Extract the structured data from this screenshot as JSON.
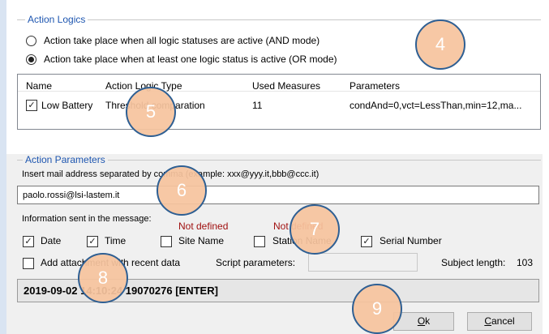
{
  "action_logics": {
    "title": "Action Logics",
    "option_and": "Action take place when all logic statuses are active (AND mode)",
    "option_or": "Action take place when at least one logic status is active (OR mode)",
    "selected": "or"
  },
  "logic_table": {
    "columns": [
      "Name",
      "Action Logic Type",
      "Used Measures",
      "Parameters"
    ],
    "rows": [
      {
        "checked": true,
        "name": "Low Battery",
        "type": "Threshold comparation",
        "measures": "11",
        "parameters": "condAnd=0,vct=LessThan,min=12,ma..."
      }
    ]
  },
  "action_parameters": {
    "title": "Action Parameters",
    "mail_label": "Insert mail address separated by comma (example: xxx@yyy.it,bbb@ccc.it)",
    "mail_value": "paolo.rossi@lsi-lastem.it",
    "info_label": "Information sent in the message:",
    "not_defined_1": "Not defined",
    "not_defined_2": "Not defined",
    "checkboxes": [
      {
        "label": "Date",
        "checked": true
      },
      {
        "label": "Time",
        "checked": true
      },
      {
        "label": "Site Name",
        "checked": false
      },
      {
        "label": "Station Name",
        "checked": false
      },
      {
        "label": "Serial Number",
        "checked": true
      }
    ],
    "attachment_label": "Add attachment with recent data",
    "attachment_checked": false,
    "script_label": "Script parameters:",
    "script_value": "",
    "subject_length_label": "Subject length:",
    "subject_length_value": "103",
    "preview": "2019-09-02 14:10:24 19070276 [ENTER]"
  },
  "buttons": {
    "ok_mnemonic": "O",
    "ok_rest": "k",
    "cancel_mnemonic": "C",
    "cancel_rest": "ancel"
  },
  "callouts": [
    "4",
    "5",
    "6",
    "7",
    "8",
    "9"
  ],
  "colors": {
    "callout_fill": "#f6c49e",
    "callout_border": "#2e5f93",
    "group_title": "#1e56b0",
    "not_defined": "#a01010"
  }
}
